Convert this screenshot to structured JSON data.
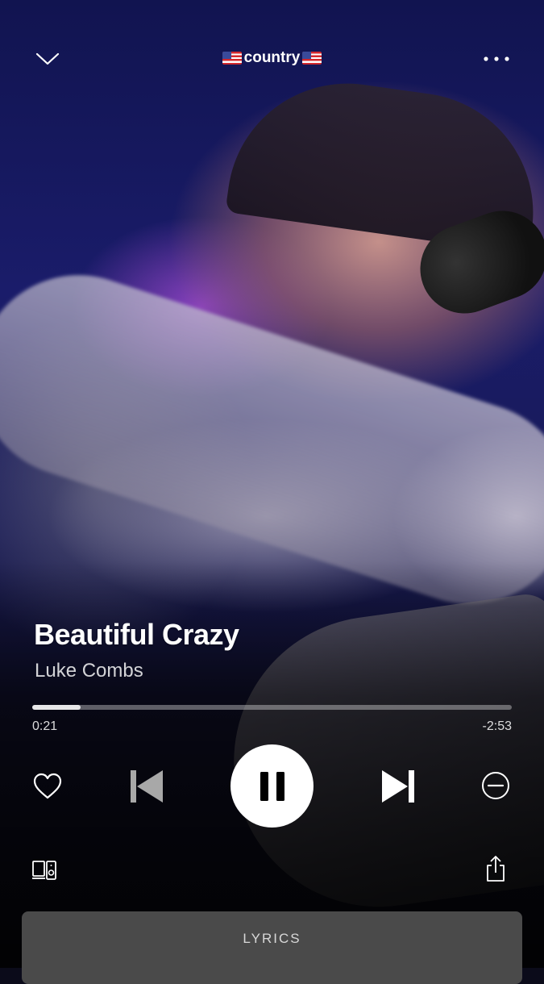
{
  "header": {
    "playlist_name": "country",
    "collapse_icon": "chevron-down-icon",
    "more_icon": "more-options-icon"
  },
  "track": {
    "title": "Beautiful Crazy",
    "artist": "Luke Combs",
    "elapsed": "0:21",
    "remaining": "-2:53",
    "progress_fraction": 0.1
  },
  "controls": {
    "like_icon": "heart-icon",
    "previous_icon": "skip-previous-icon",
    "play_state_icon": "pause-icon",
    "next_icon": "skip-next-icon",
    "hide_icon": "minus-circle-icon"
  },
  "footer": {
    "devices_icon": "connect-devices-icon",
    "share_icon": "share-icon",
    "lyrics_label": "LYRICS"
  }
}
